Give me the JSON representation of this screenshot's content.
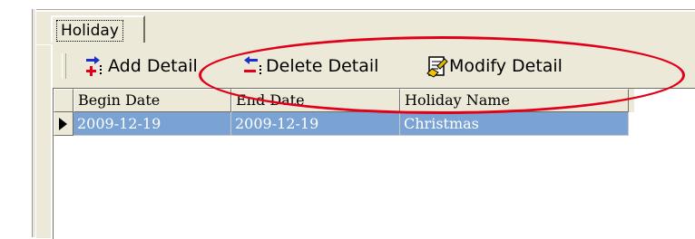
{
  "tab": {
    "label": "Holiday"
  },
  "toolbar": {
    "add_label": "Add Detail",
    "delete_label": "Delete Detail",
    "modify_label": "Modify Detail",
    "add_icon": "add-row-icon",
    "delete_icon": "delete-row-icon",
    "modify_icon": "modify-row-icon"
  },
  "grid": {
    "columns": [
      "Begin Date",
      "End Date",
      "Holiday Name"
    ],
    "rows": [
      {
        "begin": "2009-12-19",
        "end": "2009-12-19",
        "name": "Christmas",
        "selected": true
      }
    ]
  },
  "colors": {
    "selection": "#7aa3d4",
    "annotation": "#e0001a",
    "face": "#ece9d8"
  }
}
